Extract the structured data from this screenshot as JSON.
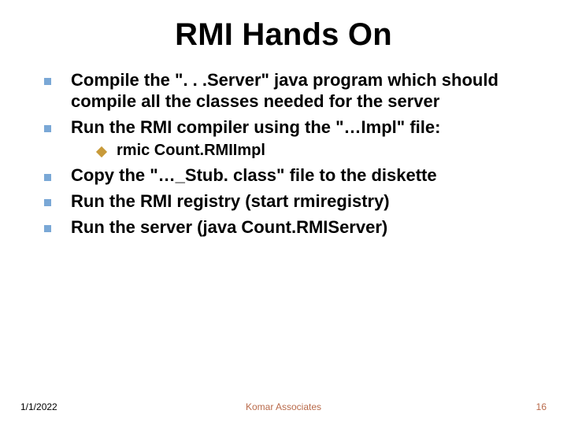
{
  "title": "RMI Hands On",
  "bullets": {
    "b1": "Compile the \". . .Server\" java program which should compile all the classes needed for the server",
    "b2": "Run the RMI compiler using the \"…Impl\" file:",
    "b2a_prefix": "rmic",
    "b2a_rest": "  Count.RMIImpl",
    "b3": "Copy the \"…_Stub. class\" file to the diskette",
    "b4": "Run the RMI registry (start rmiregistry)",
    "b5": "Run the server (java Count.RMIServer)"
  },
  "footer": {
    "date": "1/1/2022",
    "center": "Komar Associates",
    "page": "16"
  }
}
